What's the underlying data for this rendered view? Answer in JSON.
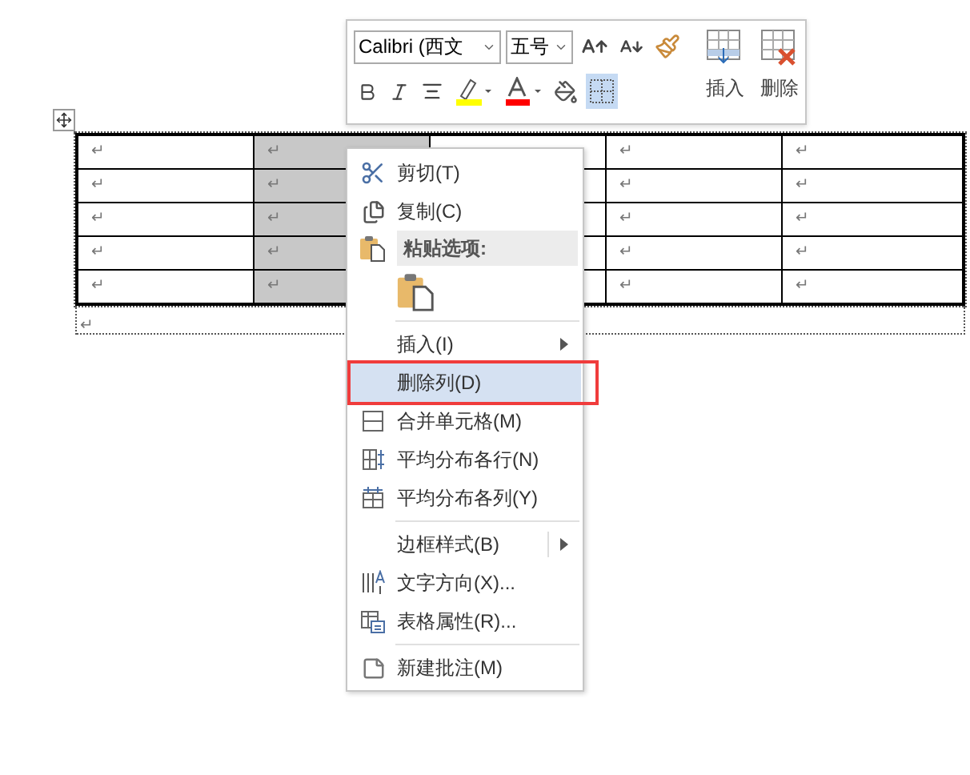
{
  "toolbar": {
    "font": "Calibri (西文",
    "size": "五号",
    "borders_selected": true,
    "actions": [
      {
        "kind": "insert",
        "label": "插入"
      },
      {
        "kind": "delete",
        "label": "删除"
      }
    ]
  },
  "table": {
    "columns": [
      {
        "selected": false
      },
      {
        "selected": true
      },
      {
        "selected": false
      },
      {
        "selected": false
      },
      {
        "selected": false
      }
    ],
    "rows": [
      {
        "cells": [
          "↵",
          "↵",
          null,
          "↵",
          "↵"
        ]
      },
      {
        "cells": [
          "↵",
          "↵",
          null,
          "↵",
          "↵"
        ]
      },
      {
        "cells": [
          "↵",
          "↵",
          null,
          "↵",
          "↵"
        ]
      },
      {
        "cells": [
          "↵",
          "↵",
          null,
          "↵",
          "↵"
        ]
      },
      {
        "cells": [
          "↵",
          "↵",
          null,
          "↵",
          "↵"
        ]
      }
    ]
  },
  "paragraph_mark": "↵",
  "context_menu": {
    "items": [
      {
        "kind": "item",
        "label": "剪切(T)",
        "highlighted": false,
        "marked": false
      },
      {
        "kind": "item",
        "label": "复制(C)",
        "highlighted": false,
        "marked": false
      },
      {
        "kind": "header",
        "label": "粘贴选项:"
      },
      {
        "kind": "paste_option"
      },
      {
        "kind": "separator"
      },
      {
        "kind": "submenu",
        "label": "插入(I)",
        "split": false
      },
      {
        "kind": "item",
        "label": "删除列(D)",
        "highlighted": true,
        "marked": true
      },
      {
        "kind": "item",
        "label": "合并单元格(M)",
        "highlighted": false,
        "marked": false
      },
      {
        "kind": "item",
        "label": "平均分布各行(N)",
        "highlighted": false,
        "marked": false
      },
      {
        "kind": "item",
        "label": "平均分布各列(Y)",
        "highlighted": false,
        "marked": false
      },
      {
        "kind": "separator"
      },
      {
        "kind": "submenu",
        "label": "边框样式(B)",
        "split": true
      },
      {
        "kind": "item",
        "label": "文字方向(X)...",
        "highlighted": false,
        "marked": false
      },
      {
        "kind": "item",
        "label": "表格属性(R)...",
        "highlighted": false,
        "marked": false
      },
      {
        "kind": "separator"
      },
      {
        "kind": "item",
        "label": "新建批注(M)",
        "highlighted": false,
        "marked": false
      }
    ]
  }
}
